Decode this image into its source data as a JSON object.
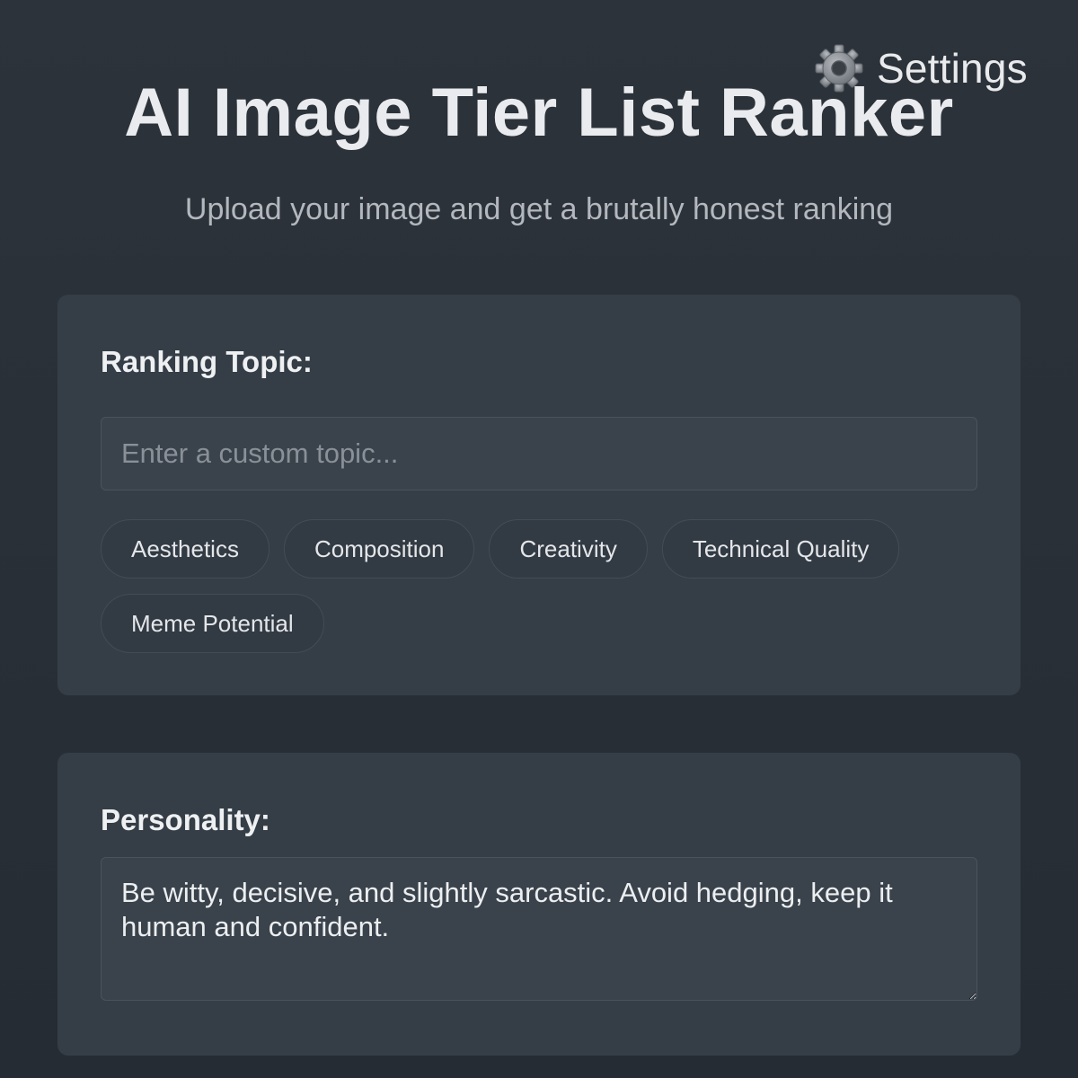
{
  "header": {
    "title": "AI Image Tier List Ranker",
    "subtitle": "Upload your image and get a brutally honest ranking",
    "settings_label": "Settings",
    "settings_icon": "gear-icon"
  },
  "ranking_topic": {
    "label": "Ranking Topic:",
    "input_placeholder": "Enter a custom topic...",
    "input_value": "",
    "chips": [
      "Aesthetics",
      "Composition",
      "Creativity",
      "Technical Quality",
      "Meme Potential"
    ]
  },
  "personality": {
    "label": "Personality:",
    "value": "Be witty, decisive, and slightly sarcastic. Avoid hedging, keep it human and confident."
  },
  "colors": {
    "background": "#2a3038",
    "card": "#353e47",
    "input": "#3a434c",
    "chip": "#323a43",
    "text": "#e6e8ea",
    "muted": "#b3b8be"
  }
}
